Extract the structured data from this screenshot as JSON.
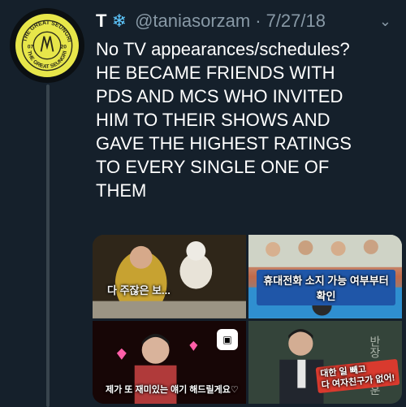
{
  "tweet": {
    "display_name": "T",
    "name_icon": "snowflake-icon",
    "handle": "@taniasorzam",
    "separator": "·",
    "date": "7/27/18",
    "menu_icon": "chevron-down-icon",
    "text": "No TV appearances/schedules?\nHE BECAME FRIENDS WITH\nPDS AND MCS WHO INVITED\nHIM TO THEIR SHOWS AND\nGAVE THE HIGHEST RATINGS\nTO EVERY SINGLE ONE OF\nTHEM",
    "avatar": {
      "top_text": "THE GREAT SEUNGRI",
      "bottom_text": "THE GREAT SEUNGRI",
      "left_number": "07",
      "right_number": "20",
      "colors": {
        "background": "#e7e64a",
        "ring": "#0b0f12"
      }
    }
  },
  "media": {
    "tiles": [
      {
        "name": "media-photo-1",
        "caption": "다 주잖은 보..."
      },
      {
        "name": "media-photo-2",
        "caption": "휴대전화 소지 가능 여부부터 확인"
      },
      {
        "name": "media-photo-3",
        "caption": "제가 또 재미있는 얘기 해드릴게요♡",
        "logo": "▣"
      },
      {
        "name": "media-photo-4",
        "caption": "대한 일 빼고\n다 여자친구가 없어!",
        "board_text": "반장 서장훈"
      }
    ]
  },
  "colors": {
    "background": "#15202b",
    "text_primary": "#ffffff",
    "text_secondary": "#8899a6",
    "thread_line": "#38444d",
    "accent_snowflake": "#5ec8ff"
  }
}
